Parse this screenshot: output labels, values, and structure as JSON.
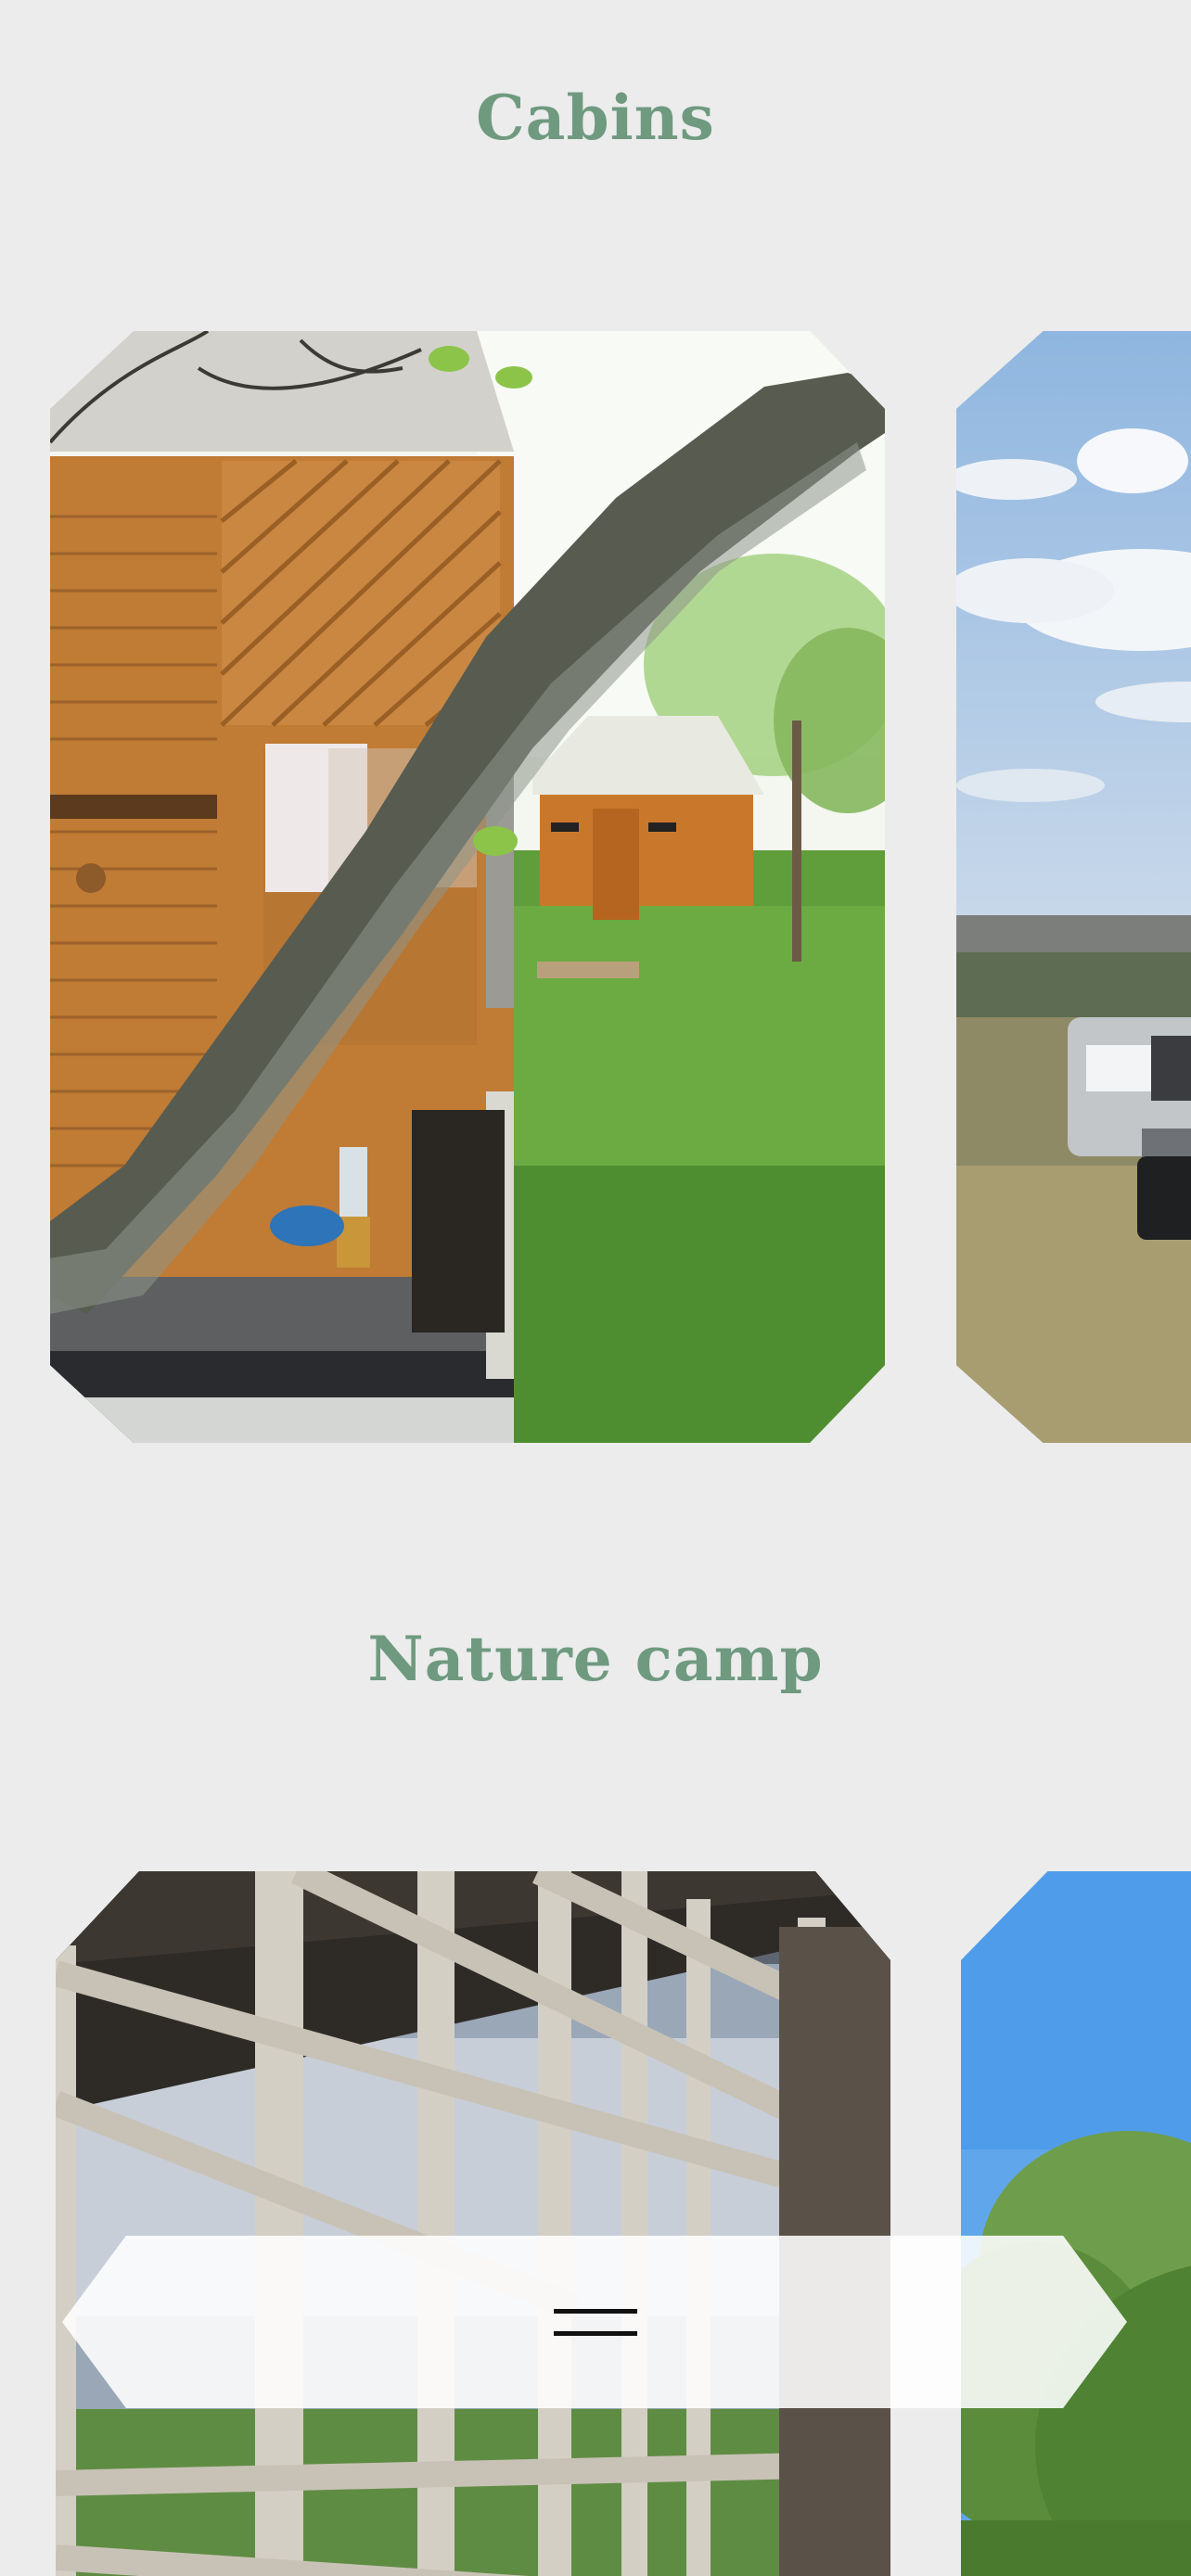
{
  "sections": {
    "cabins": {
      "title": "Cabins",
      "images": [
        "cabin-with-tree-branch-photo",
        "truck-on-hill-photo"
      ]
    },
    "nature_camp": {
      "title": "Nature camp",
      "images": [
        "wooden-lattice-shelter-photo",
        "green-trees-sky-photo"
      ]
    }
  },
  "menu": {
    "icon": "hamburger-menu-icon"
  },
  "colors": {
    "background": "#ececec",
    "title": "#6f9a80",
    "menu_bar": "#ffffff"
  }
}
